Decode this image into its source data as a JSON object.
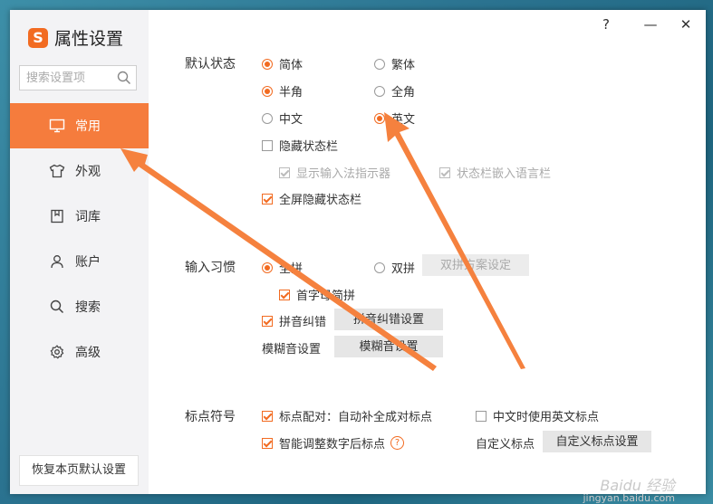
{
  "app": {
    "title": "属性设置",
    "logo_letter": "S"
  },
  "window_controls": {
    "help": "?",
    "minimize": "—",
    "close": "✕"
  },
  "search": {
    "placeholder": "搜索设置项"
  },
  "sidebar": {
    "items": [
      {
        "label": "常用",
        "icon": "monitor-icon",
        "active": true
      },
      {
        "label": "外观",
        "icon": "shirt-icon",
        "active": false
      },
      {
        "label": "词库",
        "icon": "book-icon",
        "active": false
      },
      {
        "label": "账户",
        "icon": "user-icon",
        "active": false
      },
      {
        "label": "搜索",
        "icon": "magnifier-icon",
        "active": false
      },
      {
        "label": "高级",
        "icon": "gear-icon",
        "active": false
      }
    ],
    "restore_label": "恢复本页默认设置"
  },
  "default_state": {
    "label": "默认状态",
    "simplified": "简体",
    "traditional": "繁体",
    "half_width": "半角",
    "full_width": "全角",
    "chinese": "中文",
    "english": "英文",
    "hide_status_bar": "隐藏状态栏",
    "show_ime_indicator": "显示输入法指示器",
    "status_bar_embed_lang": "状态栏嵌入语言栏",
    "fullscreen_hide_status_bar": "全屏隐藏状态栏"
  },
  "input_habit": {
    "label": "输入习惯",
    "full_pinyin": "全拼",
    "double_pinyin": "双拼",
    "double_pinyin_settings": "双拼方案设定",
    "initial_abbrev": "首字母简拼",
    "pinyin_correction": "拼音纠错",
    "pinyin_correction_settings": "拼音纠错设置",
    "fuzzy_settings_label": "模糊音设置",
    "fuzzy_settings_button": "模糊音设置"
  },
  "punctuation": {
    "label": "标点符号",
    "pairing": "标点配对：自动补全成对标点",
    "english_punct_in_chinese": "中文时使用英文标点",
    "smart_adjust": "智能调整数字后标点",
    "custom_label": "自定义标点",
    "custom_button": "自定义标点设置"
  },
  "colors": {
    "accent": "#f26b21",
    "active_nav": "#f57c3d",
    "arrow": "#f5813e"
  },
  "watermark": {
    "line1": "Baidu 经验",
    "line2": "jingyan.baidu.com"
  }
}
